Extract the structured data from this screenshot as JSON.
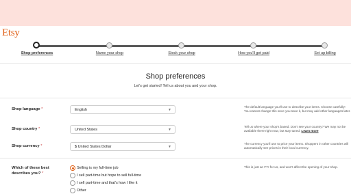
{
  "brand": {
    "logo": "Etsy"
  },
  "steps": [
    {
      "label": "Shop preferences",
      "active": true
    },
    {
      "label": "Name your shop",
      "active": false
    },
    {
      "label": "Stock your shop",
      "active": false
    },
    {
      "label": "How you'll get paid",
      "active": false
    },
    {
      "label": "Set up billing",
      "active": false
    }
  ],
  "header": {
    "title": "Shop preferences",
    "subtitle": "Let's get started! Tell us about you and your shop."
  },
  "form": {
    "required_mark": "*",
    "language": {
      "label": "Shop language",
      "value": "English",
      "help": "The default language you'll use to describe your items. Choose carefully! You cannot change this once you save it, but may add other languages later."
    },
    "country": {
      "label": "Shop country",
      "value": "United States",
      "help": "Tell us where your shop's based. Don't see your country? We may not be available there right now, but stay tuned.",
      "help_link": "Learn more"
    },
    "currency": {
      "label": "Shop currency",
      "value": "$ United States Dollar",
      "help": "The currency you'll use to price your items. Shoppers in other countries will automatically see prices in their local currency."
    },
    "describe": {
      "label": "Which of these best describes you?",
      "help": "This is just an FYI for us, and won't affect the opening of your shop.",
      "options": [
        {
          "label": "Selling is my full-time job",
          "checked": true
        },
        {
          "label": "I sell part-time but hope to sell full-time",
          "checked": false
        },
        {
          "label": "I sell part-time and that's how I like it",
          "checked": false
        },
        {
          "label": "Other",
          "checked": false
        }
      ]
    }
  },
  "colors": {
    "accent": "#e0621a",
    "band": "#fde1dc",
    "track": "#595959"
  },
  "icons": {
    "select_arrow": "chevron-down-icon",
    "step_marker": "step-circle-icon"
  }
}
